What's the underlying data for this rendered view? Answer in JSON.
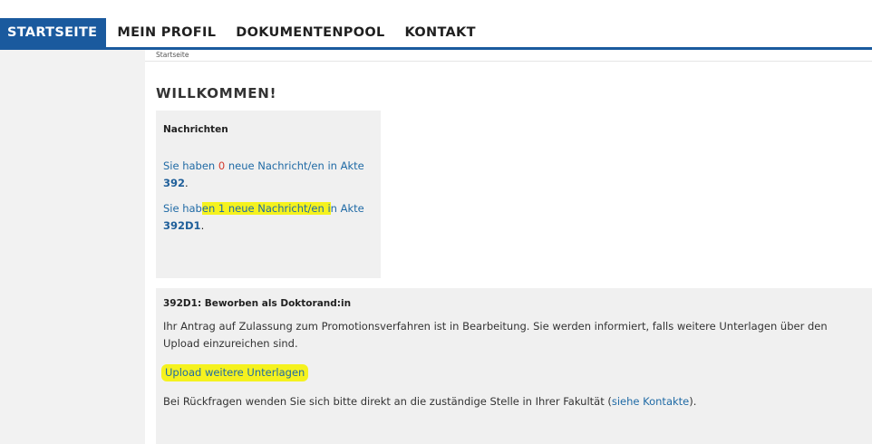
{
  "nav": {
    "items": [
      {
        "label": "STARTSEITE"
      },
      {
        "label": "MEIN PROFIL"
      },
      {
        "label": "DOKUMENTENPOOL"
      },
      {
        "label": "KONTAKT"
      }
    ]
  },
  "breadcrumb": "Startseite",
  "page_title": "WILLKOMMEN!",
  "news": {
    "title": "Nachrichten",
    "msg1": {
      "prefix": "Sie haben ",
      "count": "0",
      "middle": " neue Nachricht/en in Akte",
      "akte": "392",
      "suffix": "."
    },
    "msg2": {
      "prefix": "Sie hab",
      "highlight": "en 1 neue Nachricht/en i",
      "middle": "n Akte",
      "akte": "392D1",
      "suffix": "."
    }
  },
  "status": {
    "title": "392D1: Beworben als Doktorand:in",
    "text": "Ihr Antrag auf Zulassung zum Promotionsverfahren ist in Bearbeitung. Sie werden informiert, falls weitere Unterlagen über den Upload einzureichen sind.",
    "upload_link": "Upload weitere Unterlagen",
    "help_prefix": "Bei Rückfragen wenden Sie sich bitte direkt an die zuständige Stelle in Ihrer Fakultät (",
    "help_link": "siehe Kontakte",
    "help_suffix": ")."
  },
  "colors": {
    "accent": "#1a5a9e",
    "link": "#1f6aa5",
    "highlight": "#f5f21e",
    "count_red": "#d23a2e"
  }
}
